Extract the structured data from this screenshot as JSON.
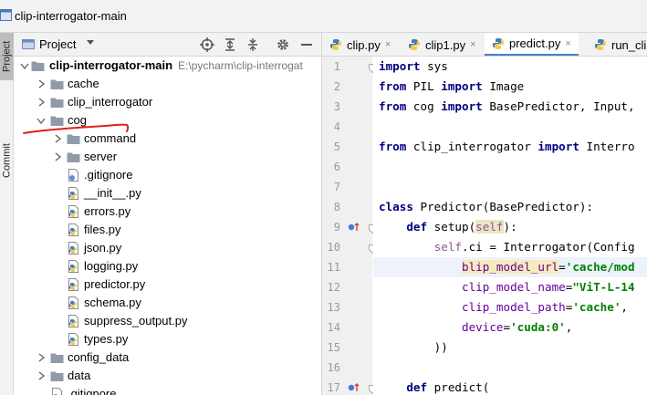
{
  "window": {
    "title": "clip-interrogator-main"
  },
  "left_strip": {
    "project_tab": "Project",
    "commit_tab": "Commit"
  },
  "project_panel": {
    "title": "Project",
    "view_icon": "chevron-down-icon"
  },
  "tree": {
    "root": {
      "name": "clip-interrogator-main",
      "path": "E:\\pycharm\\clip-interrogat"
    },
    "rows": [
      {
        "label": "cache",
        "type": "folder",
        "expanded": false
      },
      {
        "label": "clip_interrogator",
        "type": "folder",
        "expanded": false
      },
      {
        "label": "cog",
        "type": "folder",
        "expanded": true
      },
      {
        "label": "command",
        "type": "folder",
        "expanded": false
      },
      {
        "label": "server",
        "type": "folder",
        "expanded": false
      },
      {
        "label": ".gitignore",
        "type": "file"
      },
      {
        "label": "__init__.py",
        "type": "python"
      },
      {
        "label": "errors.py",
        "type": "python"
      },
      {
        "label": "files.py",
        "type": "python"
      },
      {
        "label": "json.py",
        "type": "python"
      },
      {
        "label": "logging.py",
        "type": "python"
      },
      {
        "label": "predictor.py",
        "type": "python"
      },
      {
        "label": "schema.py",
        "type": "python"
      },
      {
        "label": "suppress_output.py",
        "type": "python"
      },
      {
        "label": "types.py",
        "type": "python"
      },
      {
        "label": "config_data",
        "type": "folder",
        "expanded": false
      },
      {
        "label": "data",
        "type": "folder",
        "expanded": false
      },
      {
        "label": ".gitignore",
        "type": "file"
      }
    ]
  },
  "editor_tabs": [
    {
      "label": "clip.py",
      "active": false,
      "close": "×"
    },
    {
      "label": "clip1.py",
      "active": false,
      "close": "×"
    },
    {
      "label": "predict.py",
      "active": true,
      "close": "×"
    },
    {
      "label": "run_cli.py",
      "active": false,
      "close": ""
    }
  ],
  "editor": {
    "line_numbers": [
      "1",
      "2",
      "3",
      "4",
      "5",
      "6",
      "7",
      "8",
      "9",
      "10",
      "11",
      "12",
      "13",
      "14",
      "15",
      "16",
      "17"
    ],
    "lines": {
      "l1": [
        "import",
        " sys"
      ],
      "l2": [
        "from",
        " PIL ",
        "import",
        " Image"
      ],
      "l3": [
        "from",
        " cog ",
        "import",
        " BasePredictor, Input,"
      ],
      "l5": [
        "from",
        " clip_interrogator ",
        "import",
        " Interro"
      ],
      "l8": [
        "class",
        " Predictor(BasePredictor):"
      ],
      "l9": [
        "    ",
        "def",
        " setup(",
        "self",
        "):"
      ],
      "l10": [
        "        ",
        "self",
        ".ci = Interrogator(Config"
      ],
      "l11": [
        "            ",
        "blip_model_url",
        "=",
        "'cache/mod"
      ],
      "l12": [
        "            ",
        "clip_model_name",
        "=",
        "\"ViT-L-14"
      ],
      "l13": [
        "            ",
        "clip_model_path",
        "=",
        "'cache'",
        ","
      ],
      "l14": [
        "            ",
        "device",
        "=",
        "'cuda:0'",
        ","
      ],
      "l15": [
        "        ))"
      ],
      "l17": [
        "    ",
        "def",
        " predict("
      ]
    }
  },
  "colors": {
    "keyword": "#000080",
    "string": "#008000",
    "self": "#94558d",
    "kwarg": "#660099",
    "active_tab": "#4083c9",
    "annotation": "#e0201c"
  }
}
